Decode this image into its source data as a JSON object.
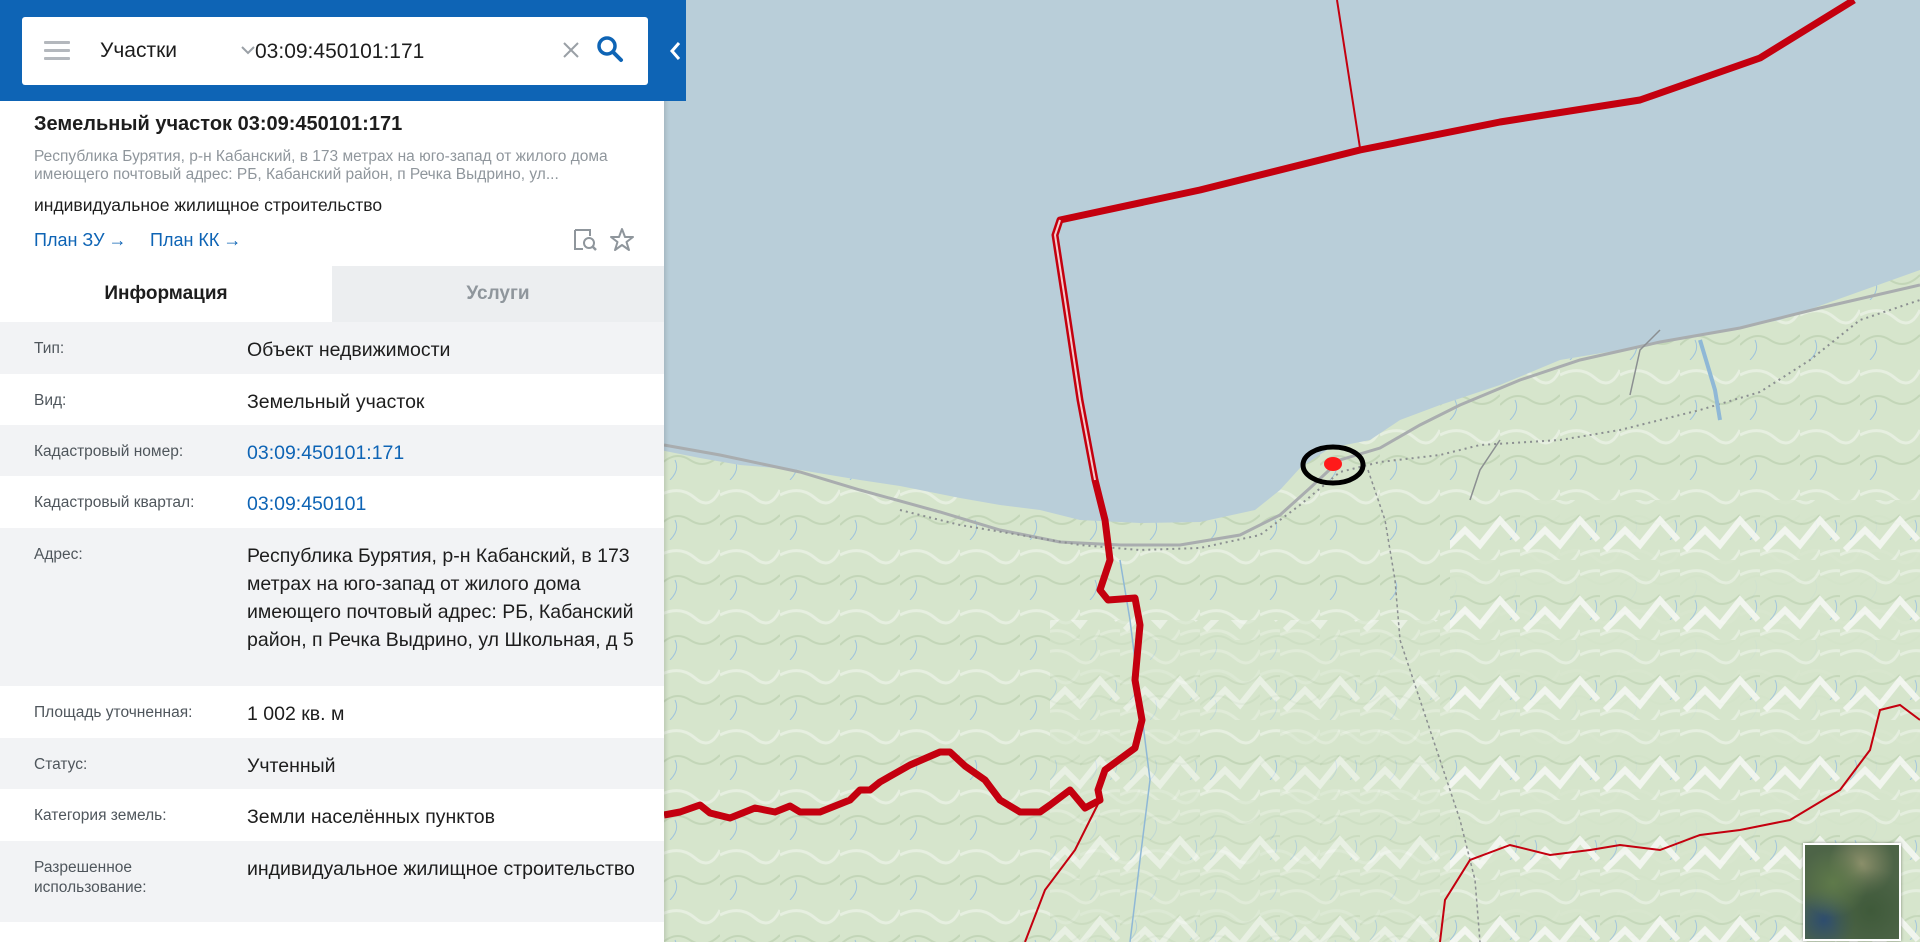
{
  "search": {
    "type_label": "Участки",
    "query": "03:09:450101:171"
  },
  "card": {
    "title": "Земельный участок 03:09:450101:171",
    "address_short": "Республика Бурятия, р-н Кабанский, в 173 метрах на юго-запад от жилого дома имеющего почтовый адрес: РБ, Кабанский район, п Речка Выдрино, ул...",
    "use": "индивидуальное жилищное строительство",
    "link_plan_zu": "План ЗУ",
    "link_plan_kk": "План КК",
    "arrow": "→"
  },
  "tabs": {
    "info": "Информация",
    "services": "Услуги"
  },
  "info": {
    "rows": [
      {
        "key": "Тип:",
        "value": "Объект недвижимости"
      },
      {
        "key": "Вид:",
        "value": "Земельный участок"
      },
      {
        "key": "Кадастровый номер:",
        "value": "03:09:450101:171"
      },
      {
        "key": "Кадастровый квартал:",
        "value": "03:09:450101"
      },
      {
        "key": "Адрес:",
        "value": "Республика Бурятия, р-н Кабанский, в 173 метрах на юго-запад от жилого дома имеющего почтовый адрес: РБ, Кабанский район, п Речка Выдрино, ул Школьная, д 5"
      },
      {
        "key": "Площадь уточненная:",
        "value": "1 002 кв. м"
      },
      {
        "key": "Статус:",
        "value": "Учтенный"
      },
      {
        "key": "Категория земель:",
        "value": "Земли населённых пунктов"
      },
      {
        "key": "Разрешенное использование:",
        "value": "индивидуальное жилищное строительство"
      }
    ]
  },
  "colors": {
    "brand_blue": "#0e64b5",
    "water": "#b9ced9",
    "land": "#d8e6d0",
    "boundary_red": "#c4000f",
    "marker_red": "#ff1a1a"
  }
}
